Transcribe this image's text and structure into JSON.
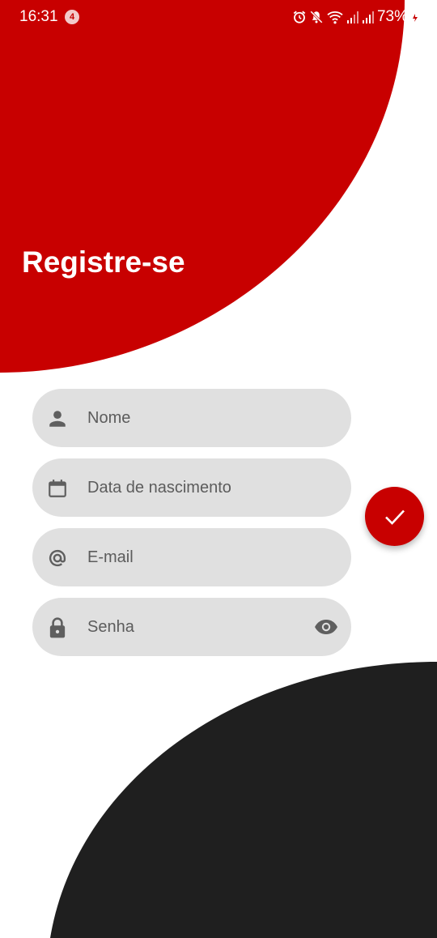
{
  "colors": {
    "accent": "#c80000",
    "dark_shape": "#1f1f1f",
    "field_background": "#e0e0e0",
    "icon": "#5f5f5f"
  },
  "status_bar": {
    "time": "16:31",
    "notification_count": "4",
    "battery": "73%",
    "icons": [
      "alarm-icon",
      "mute-icon",
      "wifi-icon",
      "signal-icon",
      "signal-icon",
      "battery-charging-icon"
    ]
  },
  "header": {
    "title": "Registre-se"
  },
  "form": {
    "fields": [
      {
        "icon": "person-icon",
        "placeholder": "Nome",
        "value": ""
      },
      {
        "icon": "calendar-icon",
        "placeholder": "Data de nascimento",
        "value": ""
      },
      {
        "icon": "at-icon",
        "placeholder": "E-mail",
        "value": ""
      },
      {
        "icon": "lock-icon",
        "placeholder": "Senha",
        "value": "",
        "trailing_icon": "eye-icon"
      }
    ]
  },
  "fab": {
    "icon": "check-icon"
  }
}
